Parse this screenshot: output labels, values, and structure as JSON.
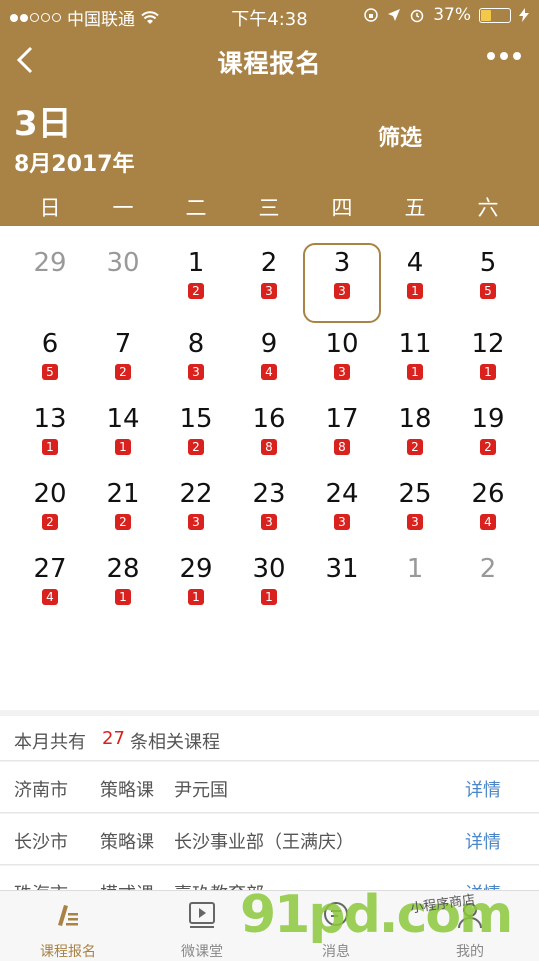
{
  "status_bar": {
    "carrier": "中国联通",
    "time": "下午4:38",
    "battery": "37%",
    "battery_level": 0.37
  },
  "header": {
    "title": "课程报名",
    "day": "3日",
    "month": "8月2017年",
    "filter_label": "筛选",
    "weekdays": [
      "日",
      "一",
      "二",
      "三",
      "四",
      "五",
      "六"
    ]
  },
  "calendar": {
    "selected_day": "3",
    "weeks": [
      [
        {
          "d": "29",
          "g": true,
          "c": ""
        },
        {
          "d": "30",
          "g": true,
          "c": ""
        },
        {
          "d": "1",
          "g": false,
          "c": "2"
        },
        {
          "d": "2",
          "g": false,
          "c": "3"
        },
        {
          "d": "3",
          "g": false,
          "c": "3"
        },
        {
          "d": "4",
          "g": false,
          "c": "1"
        },
        {
          "d": "5",
          "g": false,
          "c": "5"
        }
      ],
      [
        {
          "d": "6",
          "g": false,
          "c": "5"
        },
        {
          "d": "7",
          "g": false,
          "c": "2"
        },
        {
          "d": "8",
          "g": false,
          "c": "3"
        },
        {
          "d": "9",
          "g": false,
          "c": "4"
        },
        {
          "d": "10",
          "g": false,
          "c": "3"
        },
        {
          "d": "11",
          "g": false,
          "c": "1"
        },
        {
          "d": "12",
          "g": false,
          "c": "1"
        }
      ],
      [
        {
          "d": "13",
          "g": false,
          "c": "1"
        },
        {
          "d": "14",
          "g": false,
          "c": "1"
        },
        {
          "d": "15",
          "g": false,
          "c": "2"
        },
        {
          "d": "16",
          "g": false,
          "c": "8"
        },
        {
          "d": "17",
          "g": false,
          "c": "8"
        },
        {
          "d": "18",
          "g": false,
          "c": "2"
        },
        {
          "d": "19",
          "g": false,
          "c": "2"
        }
      ],
      [
        {
          "d": "20",
          "g": false,
          "c": "2"
        },
        {
          "d": "21",
          "g": false,
          "c": "2"
        },
        {
          "d": "22",
          "g": false,
          "c": "3"
        },
        {
          "d": "23",
          "g": false,
          "c": "3"
        },
        {
          "d": "24",
          "g": false,
          "c": "3"
        },
        {
          "d": "25",
          "g": false,
          "c": "3"
        },
        {
          "d": "26",
          "g": false,
          "c": "4"
        }
      ],
      [
        {
          "d": "27",
          "g": false,
          "c": "4"
        },
        {
          "d": "28",
          "g": false,
          "c": "1"
        },
        {
          "d": "29",
          "g": false,
          "c": "1"
        },
        {
          "d": "30",
          "g": false,
          "c": "1"
        },
        {
          "d": "31",
          "g": false,
          "c": ""
        },
        {
          "d": "1",
          "g": true,
          "c": ""
        },
        {
          "d": "2",
          "g": true,
          "c": ""
        }
      ]
    ]
  },
  "summary": {
    "prefix": "本月共有",
    "count": "27",
    "suffix": "条相关课程"
  },
  "courses": [
    {
      "city": "济南市",
      "type": "策略课",
      "org": "尹元国",
      "action": "详情"
    },
    {
      "city": "长沙市",
      "type": "策略课",
      "org": "长沙事业部（王满庆）",
      "action": "详情"
    },
    {
      "city": "珠海市",
      "type": "模式课",
      "org": "嘉玖教育部",
      "action": "详情"
    }
  ],
  "tabs": [
    {
      "label": "课程报名",
      "icon": "pen-icon",
      "active": true
    },
    {
      "label": "微课堂",
      "icon": "video-icon",
      "active": false
    },
    {
      "label": "消息",
      "icon": "message-icon",
      "active": false
    },
    {
      "label": "我的",
      "icon": "person-icon",
      "active": false
    }
  ],
  "watermark": {
    "text": "91pd.com",
    "small": "小程序商店"
  },
  "colors": {
    "brand": "#a98245",
    "badge": "#d9211e",
    "link": "#4a86c8"
  }
}
